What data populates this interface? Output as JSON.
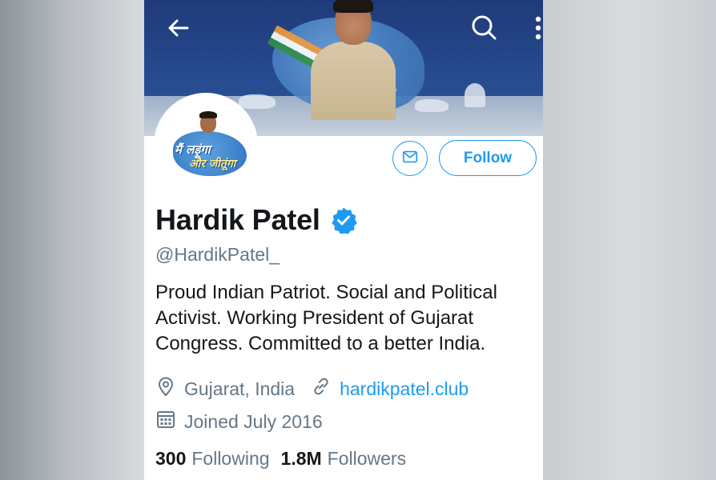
{
  "profile": {
    "name": "Hardik Patel",
    "handle": "@HardikPatel_",
    "bio": "Proud Indian Patriot. Social and Political Activist. Working President of Gujarat Congress. Committed to a better India.",
    "location": "Gujarat, India",
    "website": "hardikpatel.club",
    "joined": "Joined July 2016",
    "following_count": "300",
    "following_label": "Following",
    "followers_count": "1.8M",
    "followers_label": "Followers",
    "verified": true
  },
  "avatar": {
    "slogan_line1": "मैं लड़ूंगा",
    "slogan_line2": "और जीतूंगा"
  },
  "actions": {
    "follow_label": "Follow"
  },
  "icons": {
    "back": "arrow-left-icon",
    "search": "search-icon",
    "more": "more-vertical-icon",
    "message": "mail-icon",
    "location": "location-pin-icon",
    "link": "link-icon",
    "calendar": "calendar-icon",
    "verified": "verified-badge-icon"
  },
  "colors": {
    "accent": "#1d9bf0",
    "muted": "#657786",
    "text": "#14171a"
  }
}
